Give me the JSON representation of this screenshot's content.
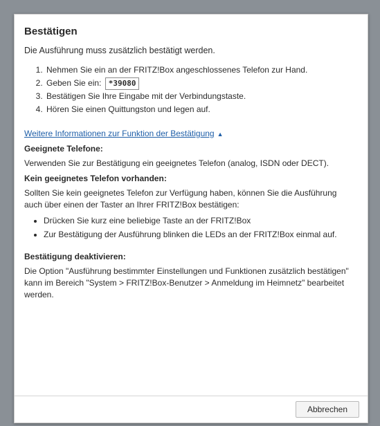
{
  "dialog": {
    "title": "Bestätigen",
    "intro": "Die Ausführung muss zusätzlich bestätigt werden.",
    "steps": [
      "Nehmen Sie ein an der FRITZ!Box angeschlossenes Telefon zur Hand.",
      "Geben Sie ein:",
      "Bestätigen Sie Ihre Eingabe mit der Verbindungstaste.",
      "Hören Sie einen Quittungston und legen auf."
    ],
    "code": "*39080",
    "more_info_link": "Weitere Informationen zur Funktion der Bestätigung",
    "suitable_phones": {
      "heading": "Geeignete Telefone:",
      "text": "Verwenden Sie zur Bestätigung ein geeignetes Telefon (analog, ISDN oder DECT)."
    },
    "no_phone": {
      "heading": "Kein geeignetes Telefon vorhanden:",
      "text": "Sollten Sie kein geeignetes Telefon zur Verfügung haben, können Sie die Ausführung auch über einen der Taster an Ihrer FRITZ!Box bestätigen:",
      "bullets": [
        "Drücken Sie kurz eine beliebige Taste an der FRITZ!Box",
        "Zur Bestätigung der Ausführung blinken die LEDs an der FRITZ!Box einmal auf."
      ]
    },
    "deactivate": {
      "heading": "Bestätigung deaktivieren:",
      "text": "Die Option \"Ausführung bestimmter Einstellungen und Funktionen zusätzlich bestätigen\" kann im Bereich \"System > FRITZ!Box-Benutzer > Anmeldung im Heimnetz\" bearbeitet werden."
    },
    "cancel_button": "Abbrechen"
  }
}
